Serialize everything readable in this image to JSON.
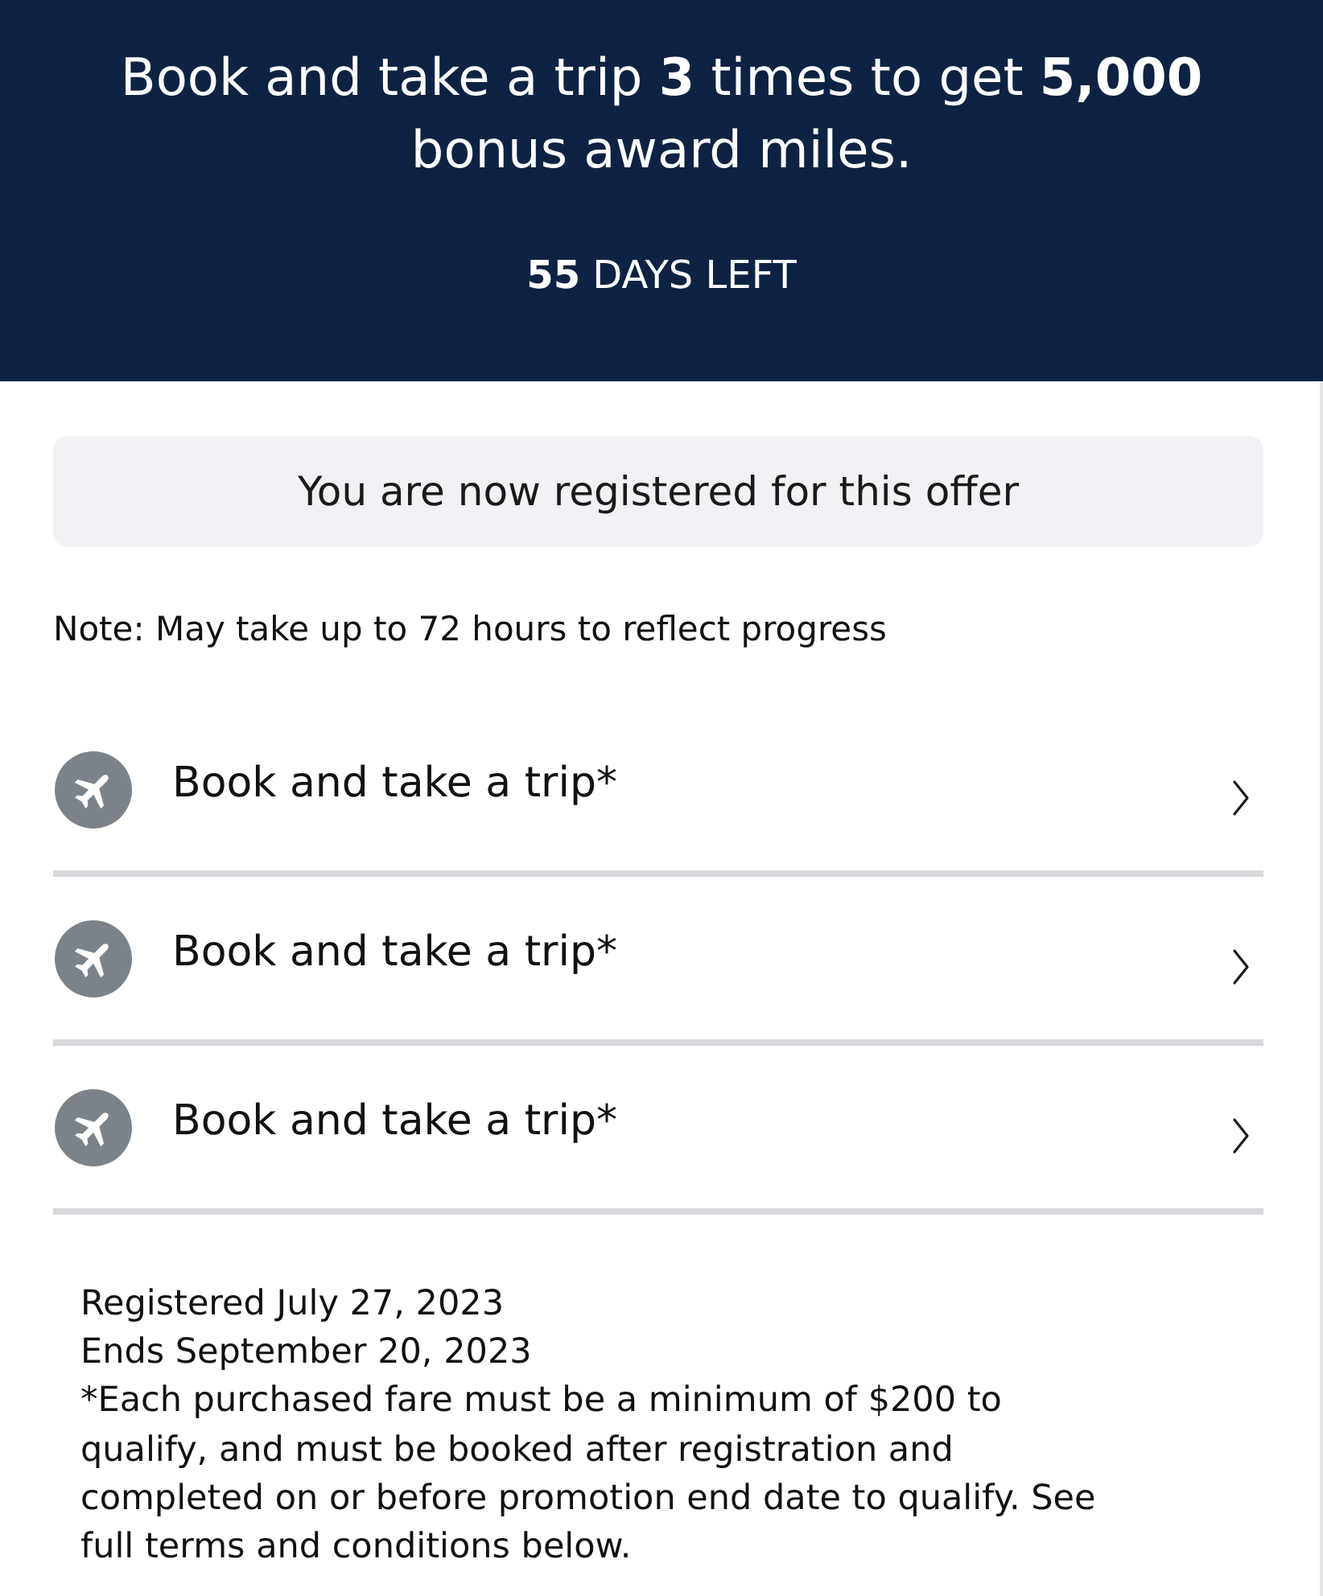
{
  "header": {
    "headline": "Book and take a trip **3** times to get **5,000** bonus award miles.",
    "days_left": "**55** DAYS LEFT"
  },
  "registration_status": "You are now registered for this offer",
  "note": "Note: May take up to 72 hours to reflect progress",
  "tasks": [
    {
      "label": "Book and take a trip*"
    },
    {
      "label": "Book and take a trip*"
    },
    {
      "label": "Book and take a trip*"
    }
  ],
  "details": {
    "registered": "Registered July 27, 2023",
    "ends": "Ends September 20, 2023",
    "terms": "*Each purchased fare must be a minimum of $200 to qualify, and must be booked after registration and completed on or before promotion end date to qualify. See full terms and conditions below."
  }
}
